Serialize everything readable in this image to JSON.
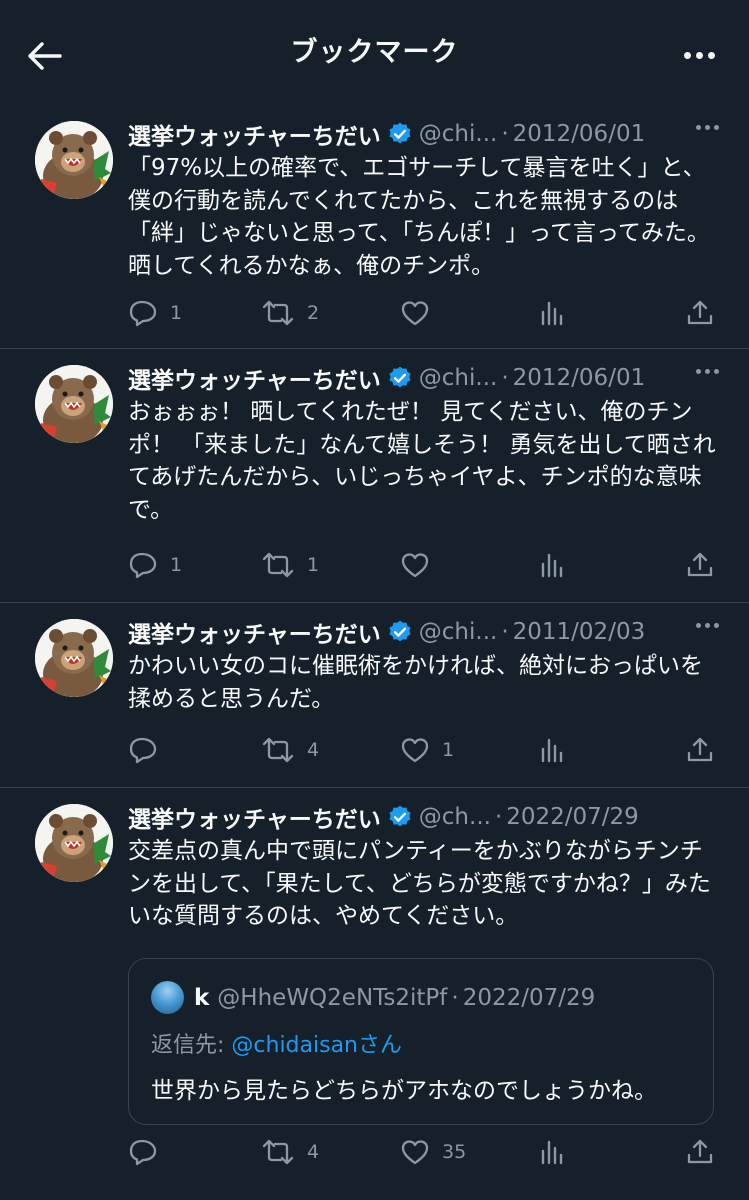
{
  "header": {
    "title": "ブックマーク"
  },
  "tweets": [
    {
      "name": "選挙ウォッチャーちだい",
      "handle": "@chi...",
      "date": "2012/06/01",
      "text": "「97%以上の確率で、エゴサーチして暴言を吐く」と、僕の行動を読んでくれてたから、これを無視するのは「絆」じゃないと思って、「ちんぽ！」って言ってみた。晒してくれるかなぁ、俺のチンポ。",
      "replies": "1",
      "retweets": "2",
      "likes": "",
      "views": ""
    },
    {
      "name": "選挙ウォッチャーちだい",
      "handle": "@chi...",
      "date": "2012/06/01",
      "text": "おぉぉぉ！ 晒してくれたぜ！ 見てください、俺のチンポ！ 「来ました」なんて嬉しそう！ 勇気を出して晒されてあげたんだから、いじっちゃイヤよ、チンポ的な意味で。",
      "replies": "1",
      "retweets": "1",
      "likes": "",
      "views": ""
    },
    {
      "name": "選挙ウォッチャーちだい",
      "handle": "@chi...",
      "date": "2011/02/03",
      "text": "かわいい女のコに催眠術をかければ、絶対におっぱいを揉めると思うんだ。",
      "replies": "",
      "retweets": "4",
      "likes": "1",
      "views": ""
    },
    {
      "name": "選挙ウォッチャーちだい",
      "handle": "@ch...",
      "date": "2022/07/29",
      "text": "交差点の真ん中で頭にパンティーをかぶりながらチンチンを出して、「果たして、どちらが変態ですかね？」みたいな質問するのは、やめてください。",
      "replies": "",
      "retweets": "4",
      "likes": "35",
      "views": "",
      "quote": {
        "name": "k",
        "handle": "@HheWQ2eNTs2itPf",
        "date": "2022/07/29",
        "reply_prefix": "返信先: ",
        "reply_to": "@chidaisan",
        "reply_suffix": "さん",
        "text": "世界から見たらどちらがアホなのでしょうかね。"
      }
    }
  ],
  "colors": {
    "background": "#15202b",
    "text": "#f7f9f9",
    "muted": "#8b98a5",
    "link": "#1d9bf0",
    "border": "#38444d"
  }
}
